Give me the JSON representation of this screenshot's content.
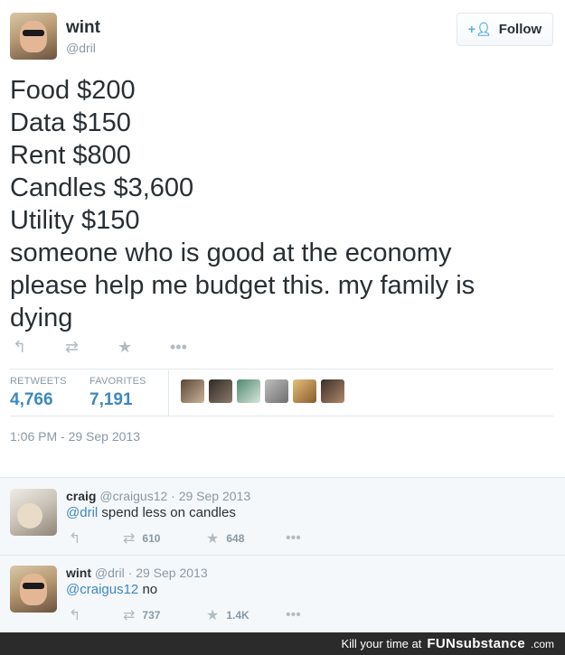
{
  "tweet": {
    "name": "wint",
    "handle": "@dril",
    "follow_label": "Follow",
    "text": "Food $200\nData $150\nRent $800\nCandles $3,600\nUtility $150\nsomeone who is good at the economy\nplease help me budget this. my family is\ndying",
    "stats": {
      "retweets_label": "RETWEETS",
      "retweets": "4,766",
      "favorites_label": "FAVORITES",
      "favorites": "7,191"
    },
    "timestamp": "1:06 PM - 29 Sep 2013",
    "icons": [
      "reply-icon",
      "retweet-icon",
      "favorite-icon",
      "more-icon"
    ]
  },
  "replies": [
    {
      "name": "craig",
      "meta": "@craigus12 · 29 Sep 2013",
      "mention": "@dril",
      "text": " spend less on candles",
      "retweets": "610",
      "favorites": "648"
    },
    {
      "name": "wint",
      "meta": "@dril · 29 Sep 2013",
      "mention": "@craigus12",
      "text": " no",
      "retweets": "737",
      "favorites": "1.4K"
    }
  ],
  "footer": {
    "tagline": "Kill your time at",
    "brand": "FUNsubstance",
    "domain": ".com"
  },
  "colors": {
    "link": "#3b88c3",
    "muted": "#8899a6",
    "text": "#292f33",
    "follow_icon": "#55acee",
    "footer_bg": "#2b2b2b"
  }
}
